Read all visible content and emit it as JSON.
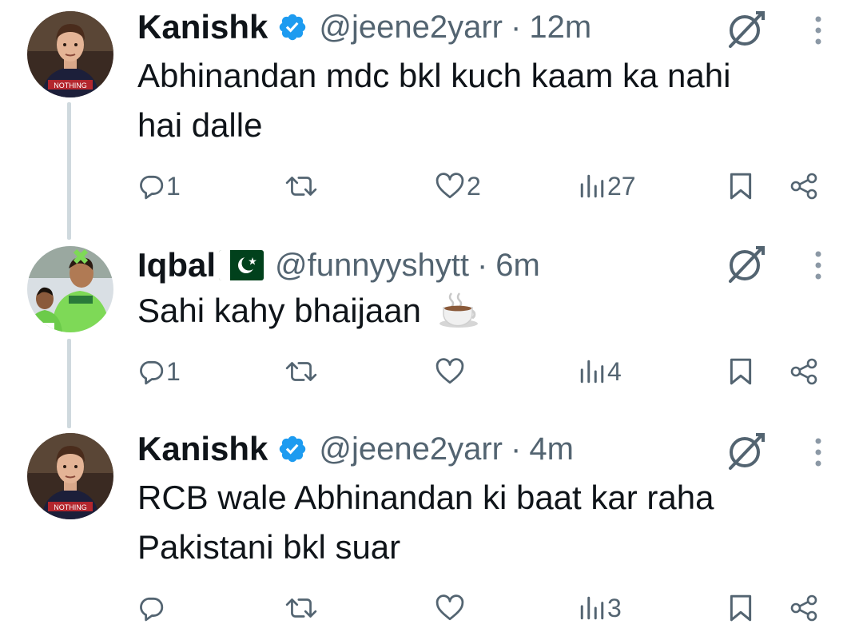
{
  "tweets": [
    {
      "name": "Kanishk",
      "verified": true,
      "handle": "@jeene2yarr",
      "separator": "·",
      "time": "12m",
      "text_lines": [
        "Abhinandan mdc bkl kuch kaam ka nahi",
        "hai dalle"
      ],
      "replies": "1",
      "retweets": "",
      "likes": "2",
      "views": "27",
      "avatar": "boy-in-rcb-jersey"
    },
    {
      "name": "Iqbal",
      "flag": "pakistan-flag",
      "handle": "@funnyyshytt",
      "separator": "·",
      "time": "6m",
      "text": "Sahi kahy bhaijaan",
      "emoji": "hot-beverage",
      "replies": "1",
      "retweets": "",
      "likes": "",
      "views": "4",
      "avatar": "cricketers-in-green"
    },
    {
      "name": "Kanishk",
      "verified": true,
      "handle": "@jeene2yarr",
      "separator": "·",
      "time": "4m",
      "text_lines": [
        "RCB wale Abhinandan ki baat kar raha",
        "Pakistani bkl suar"
      ],
      "replies": "",
      "retweets": "",
      "likes": "",
      "views": "3",
      "avatar": "boy-in-rcb-jersey"
    }
  ],
  "colors": {
    "text": "#0f1419",
    "muted": "#536471",
    "verified": "#1d9bf0",
    "thread_line": "#cfd9de",
    "flag_green": "#01411c"
  },
  "icons": [
    "reply-icon",
    "retweet-icon",
    "like-icon",
    "views-icon",
    "bookmark-icon",
    "share-icon",
    "grok-icon",
    "more-icon",
    "verified-badge-icon"
  ]
}
